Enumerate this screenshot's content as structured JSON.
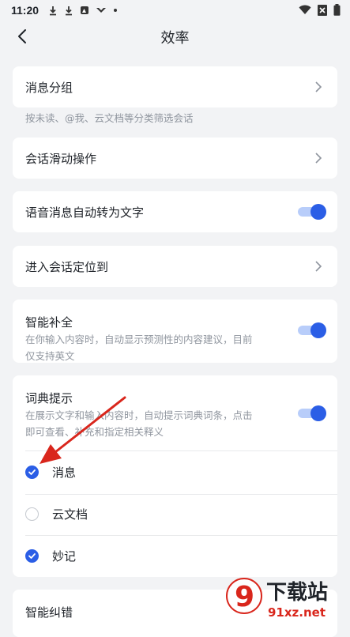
{
  "status_bar": {
    "time": "11:20",
    "left_icons": [
      "download-icon",
      "download-icon",
      "photo-app-icon",
      "bird-app-icon",
      "dot-icon"
    ],
    "right_icons": [
      "wifi-icon",
      "close-x-icon",
      "battery-icon"
    ]
  },
  "header": {
    "title": "效率",
    "back_icon": "chevron-left-icon"
  },
  "settings": {
    "message_group": {
      "label": "消息分组",
      "caption": "按未读、@我、云文档等分类筛选会话"
    },
    "swipe_actions": {
      "label": "会话滑动操作"
    },
    "voice_to_text": {
      "label": "语音消息自动转为文字",
      "enabled": true
    },
    "enter_chat_position": {
      "label": "进入会话定位到"
    },
    "smart_complete": {
      "label": "智能补全",
      "desc_line1": "在你输入内容时，自动显示预测性的内容建议，目前",
      "desc_line2": "仅支持英文",
      "enabled": true
    },
    "dictionary_hint": {
      "label": "词典提示",
      "desc_line1": "在展示文字和输入内容时，自动提示词典词条，点击",
      "desc_line2": "即可查看、补充和指定相关释义",
      "enabled": true,
      "options": [
        {
          "label": "消息",
          "checked": true
        },
        {
          "label": "云文档",
          "checked": false
        },
        {
          "label": "妙记",
          "checked": true
        }
      ]
    },
    "smart_correct": {
      "label": "智能纠错"
    }
  },
  "colors": {
    "accent": "#2b5ee6",
    "toggle_track": "#b8cdfa",
    "background": "#f2f3f5",
    "annotation_arrow": "#d9261c"
  },
  "watermark": {
    "logo_text": "9",
    "title": "下载站",
    "url": "91xz.net"
  }
}
